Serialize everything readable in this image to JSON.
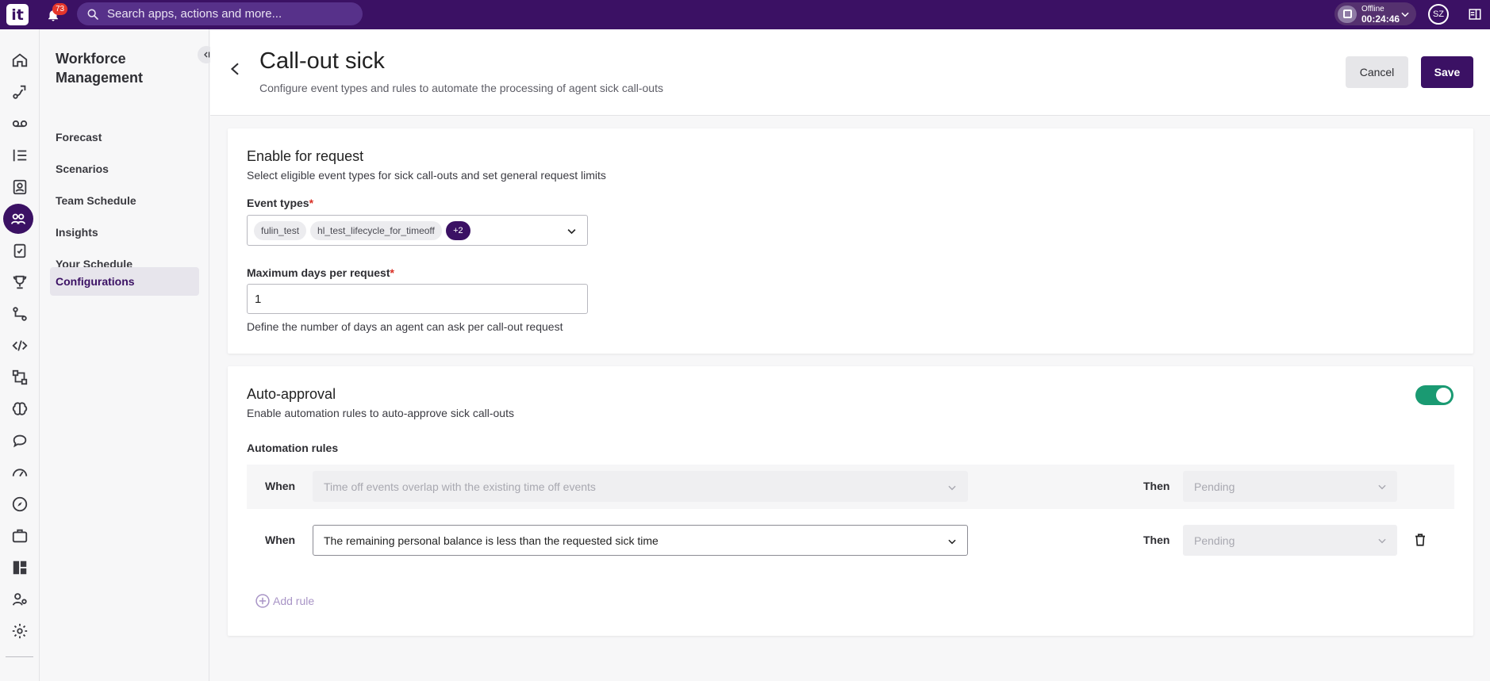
{
  "topbar": {
    "logo_text": "it",
    "notification_count": "73",
    "search_placeholder": "Search apps, actions and more...",
    "status_label": "Offline",
    "status_time": "00:24:46",
    "avatar_initials": "SZ"
  },
  "rail": {
    "icons": [
      "home-icon",
      "journey-icon",
      "voicemail-icon",
      "list-icon",
      "contact-book-icon",
      "workforce-icon",
      "clipboard-icon",
      "trophy-icon",
      "flow-icon",
      "code-icon",
      "workflow-icon",
      "brain-icon",
      "chat-icon",
      "gauge-icon",
      "compass-icon",
      "briefcase-icon",
      "dashboard-icon",
      "user-settings-icon",
      "gear-icon"
    ],
    "active_index": 5
  },
  "subnav": {
    "title": "Workforce Management",
    "items": [
      {
        "label": "Forecast"
      },
      {
        "label": "Scenarios"
      },
      {
        "label": "Team Schedule"
      },
      {
        "label": "Insights"
      },
      {
        "label": "Your Schedule"
      },
      {
        "label": "Configurations"
      }
    ],
    "active_index": 5
  },
  "header": {
    "title": "Call-out sick",
    "subtitle": "Configure event types and rules to automate the processing of agent sick call-outs",
    "cancel_label": "Cancel",
    "save_label": "Save"
  },
  "enable_card": {
    "title": "Enable for request",
    "subtitle": "Select eligible event types for sick call-outs and set general request limits",
    "event_types_label": "Event types",
    "event_type_chips": [
      "fulin_test",
      "hl_test_lifecycle_for_timeoff"
    ],
    "more_count": "+2",
    "max_days_label": "Maximum days per request",
    "max_days_value": "1",
    "max_days_help": "Define the number of days an agent can ask per call-out request"
  },
  "auto_card": {
    "title": "Auto-approval",
    "subtitle": "Enable automation rules to auto-approve sick call-outs",
    "toggle_on": true,
    "rules_label": "Automation rules",
    "rules": [
      {
        "when_label": "When",
        "condition": "Time off events overlap with the existing time off events",
        "then_label": "Then",
        "outcome": "Pending",
        "disabled": true
      },
      {
        "when_label": "When",
        "condition": "The remaining personal balance is less than the requested sick time",
        "then_label": "Then",
        "outcome": "Pending",
        "disabled": false
      }
    ],
    "add_rule_label": "Add rule"
  },
  "colors": {
    "brand": "#3b1164",
    "toggle_on": "#1a9a72",
    "required": "#d93025"
  }
}
